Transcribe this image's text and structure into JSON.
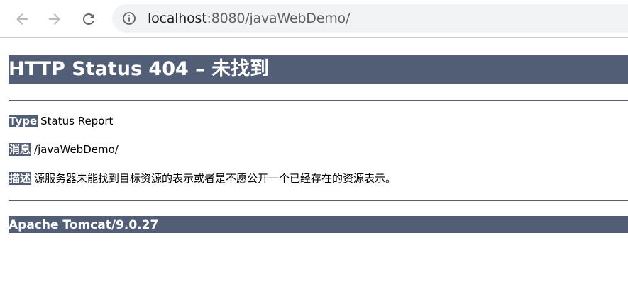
{
  "browser": {
    "url_host": "localhost",
    "url_rest": ":8080/javaWebDemo/",
    "icons": {
      "back": "arrow-left-icon",
      "forward": "arrow-right-icon",
      "reload": "reload-icon",
      "site_info": "info-icon"
    }
  },
  "page": {
    "title": "HTTP Status 404 – 未找到",
    "type_label": "Type",
    "type_value": "Status Report",
    "message_label": "消息",
    "message_value": "/javaWebDemo/",
    "description_label": "描述",
    "description_value": "源服务器未能找到目标资源的表示或者是不愿公开一个已经存在的资源表示。",
    "footer": "Apache Tomcat/9.0.27"
  },
  "colors": {
    "header_bg": "#525d76",
    "omnibox_bg": "#f1f3f4"
  }
}
